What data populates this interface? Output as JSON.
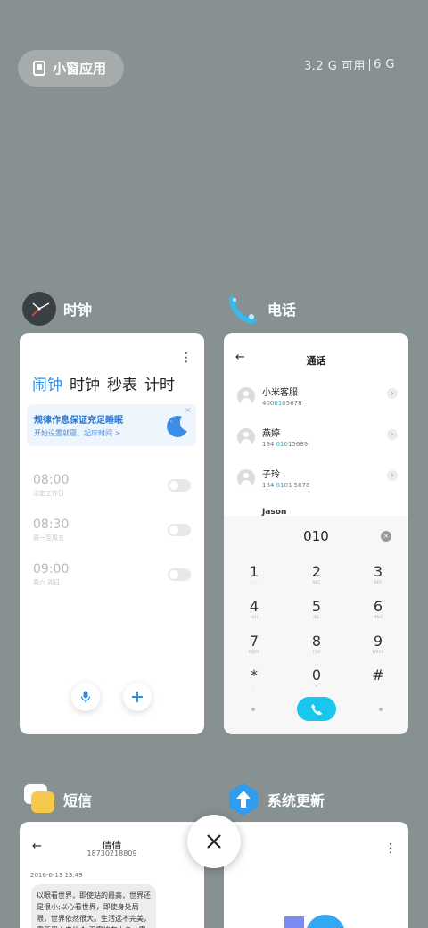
{
  "top": {
    "small_window_label": "小窗应用",
    "memory_available": "3.2 G 可用",
    "memory_total": "6 G"
  },
  "apps": {
    "clock": {
      "name": "时钟",
      "tabs": [
        "闹钟",
        "时钟",
        "秒表",
        "计时"
      ],
      "active_tab": "闹钟",
      "banner_title": "规律作息保证充足睡眠",
      "banner_subtitle": "开始设置就寝、起床时间 >",
      "banner_close": "×",
      "menu": "⋮",
      "alarms": [
        {
          "time": "08:00",
          "days": "法定工作日"
        },
        {
          "time": "08:30",
          "days": "周一至周五"
        },
        {
          "time": "09:00",
          "days": "周六 周日"
        }
      ]
    },
    "phone": {
      "name": "电话",
      "back": "←",
      "title": "通话",
      "contacts": [
        {
          "name": "小米客服",
          "num_pre": "400",
          "num_hl": "010",
          "num_post": "5678"
        },
        {
          "name": "燕婷",
          "num_pre": "184 ",
          "num_hl": "010",
          "num_post": "15689"
        },
        {
          "name": "子玲",
          "num_pre": "184 ",
          "num_hl": "0101",
          "num_post": " 5678"
        }
      ],
      "partial_contact": "Jason",
      "dial_input": "010",
      "keys": [
        {
          "d": "1",
          "l": "◌◌"
        },
        {
          "d": "2",
          "l": "ABC"
        },
        {
          "d": "3",
          "l": "DEF"
        },
        {
          "d": "4",
          "l": "GHI"
        },
        {
          "d": "5",
          "l": "JKL"
        },
        {
          "d": "6",
          "l": "MNO"
        },
        {
          "d": "7",
          "l": "PQRS"
        },
        {
          "d": "8",
          "l": "TUV"
        },
        {
          "d": "9",
          "l": "WXYZ"
        },
        {
          "d": "*",
          "l": ","
        },
        {
          "d": "0",
          "l": "+"
        },
        {
          "d": "#",
          "l": ""
        }
      ]
    },
    "sms": {
      "name": "短信",
      "contact_name": "倩倩",
      "contact_number": "18730218809",
      "timestamp": "2016-6-13 13:49",
      "message": "以眼看世界，即使站的最高，世界还是很小;以心看世界，即使身处局限，世界依然很大。生活远不完美，需要用心去体会,无需将有太多，需"
    },
    "update": {
      "name": "系统更新"
    }
  },
  "colors": {
    "background": "#879191",
    "accent_blue": "#2f8de4",
    "call_cyan": "#18c6ee"
  }
}
